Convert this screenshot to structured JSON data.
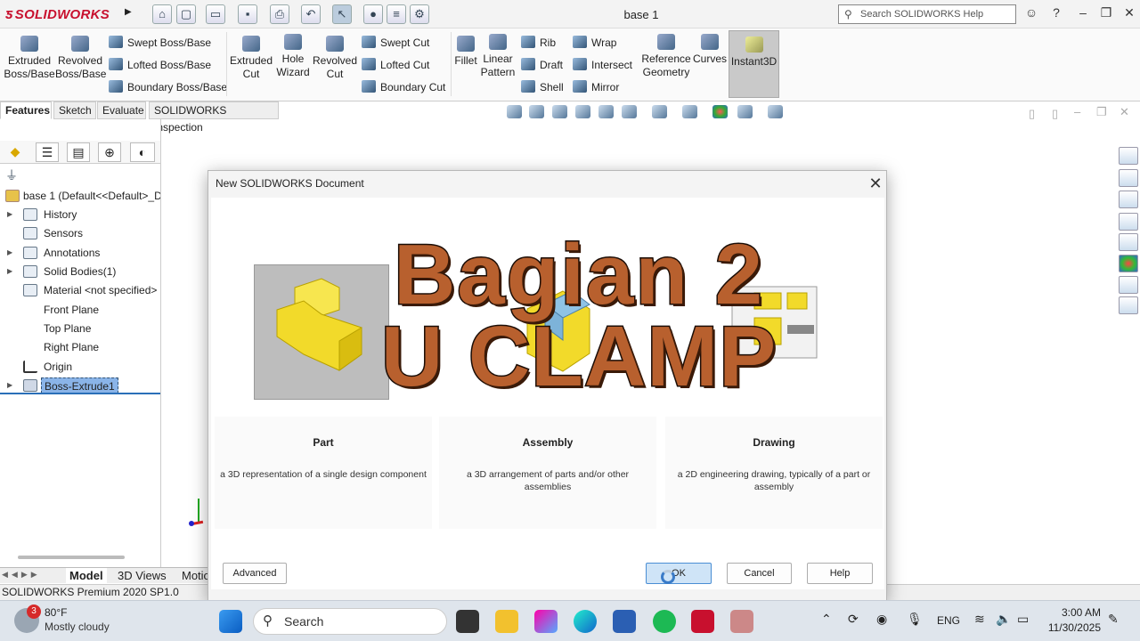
{
  "app": {
    "logo": "SOLIDWORKS",
    "doc_title": "base 1"
  },
  "search": {
    "placeholder": "Search SOLIDWORKS Help"
  },
  "ribbon": {
    "extruded_boss": "Extruded Boss/Base",
    "revolved_boss": "Revolved Boss/Base",
    "swept_boss": "Swept Boss/Base",
    "lofted_boss": "Lofted Boss/Base",
    "boundary_boss": "Boundary Boss/Base",
    "extruded_cut": "Extruded Cut",
    "hole_wizard": "Hole Wizard",
    "revolved_cut": "Revolved Cut",
    "swept_cut": "Swept Cut",
    "lofted_cut": "Lofted Cut",
    "boundary_cut": "Boundary Cut",
    "fillet": "Fillet",
    "linear_pattern": "Linear Pattern",
    "rib": "Rib",
    "draft": "Draft",
    "shell": "Shell",
    "wrap": "Wrap",
    "intersect": "Intersect",
    "mirror": "Mirror",
    "reference_geometry": "Reference Geometry",
    "curves": "Curves",
    "instant3d": "Instant3D"
  },
  "tabs": [
    "Features",
    "Sketch",
    "Evaluate",
    "SOLIDWORKS Inspection"
  ],
  "tree": {
    "root": "base 1  (Default<<Default>_D",
    "items": [
      "History",
      "Sensors",
      "Annotations",
      "Solid Bodies(1)",
      "Material <not specified>",
      "Front Plane",
      "Top Plane",
      "Right Plane",
      "Origin",
      "Boss-Extrude1"
    ]
  },
  "bottom_tabs": [
    "Model",
    "3D Views",
    "Motio"
  ],
  "status": "SOLIDWORKS Premium 2020 SP1.0",
  "dialog": {
    "title": "New SOLIDWORKS Document",
    "cards": [
      {
        "title": "Part",
        "desc": "a 3D representation of a single design component"
      },
      {
        "title": "Assembly",
        "desc": "a 3D arrangement of parts and/or other assemblies"
      },
      {
        "title": "Drawing",
        "desc": "a 2D engineering drawing, typically of a part or assembly"
      }
    ],
    "advanced": "Advanced",
    "ok": "OK",
    "cancel": "Cancel",
    "help": "Help"
  },
  "overlay": {
    "line1": "Bagian 2",
    "line2": "U CLAMP"
  },
  "taskbar": {
    "weather_temp": "80°F",
    "weather_desc": "Mostly cloudy",
    "weather_badge": "3",
    "search": "Search",
    "lang": "ENG",
    "time": "3:00 AM",
    "date": "11/30/2025"
  }
}
